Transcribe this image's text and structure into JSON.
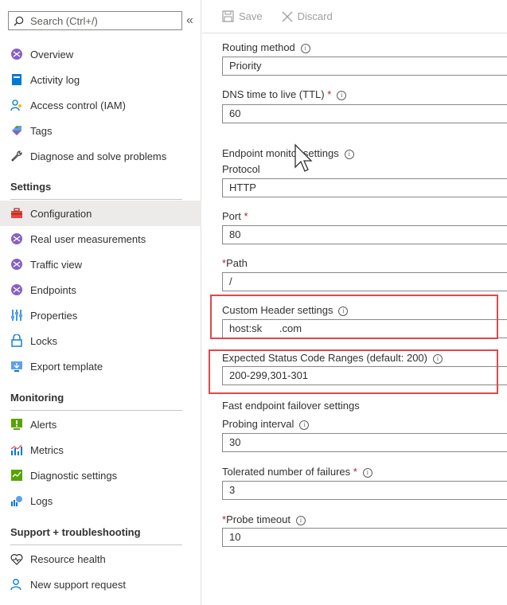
{
  "sidebar": {
    "search_placeholder": "Search (Ctrl+/)",
    "collapse": "«",
    "top_items": [
      {
        "label": "Overview",
        "icon": "overview-icon"
      },
      {
        "label": "Activity log",
        "icon": "activity-log-icon"
      },
      {
        "label": "Access control (IAM)",
        "icon": "access-control-icon"
      },
      {
        "label": "Tags",
        "icon": "tag-icon"
      },
      {
        "label": "Diagnose and solve problems",
        "icon": "wrench-icon"
      }
    ],
    "sections": [
      {
        "title": "Settings",
        "items": [
          {
            "label": "Configuration",
            "icon": "toolbox-icon",
            "active": true
          },
          {
            "label": "Real user measurements",
            "icon": "traffic-manager-icon"
          },
          {
            "label": "Traffic view",
            "icon": "traffic-manager-icon"
          },
          {
            "label": "Endpoints",
            "icon": "traffic-manager-icon"
          },
          {
            "label": "Properties",
            "icon": "properties-icon"
          },
          {
            "label": "Locks",
            "icon": "lock-icon"
          },
          {
            "label": "Export template",
            "icon": "export-icon"
          }
        ]
      },
      {
        "title": "Monitoring",
        "items": [
          {
            "label": "Alerts",
            "icon": "alert-icon"
          },
          {
            "label": "Metrics",
            "icon": "metrics-icon"
          },
          {
            "label": "Diagnostic settings",
            "icon": "diagnostic-icon"
          },
          {
            "label": "Logs",
            "icon": "logs-icon"
          }
        ]
      },
      {
        "title": "Support + troubleshooting",
        "items": [
          {
            "label": "Resource health",
            "icon": "heart-icon"
          },
          {
            "label": "New support request",
            "icon": "support-icon"
          }
        ]
      }
    ]
  },
  "toolbar": {
    "save_label": "Save",
    "discard_label": "Discard"
  },
  "form": {
    "routing_method": {
      "label": "Routing method",
      "value": "Priority"
    },
    "dns_ttl": {
      "label": "DNS time to live (TTL)",
      "required": "*",
      "value": "60"
    },
    "endpoint_monitor": {
      "label": "Endpoint monitor settings"
    },
    "protocol": {
      "label": "Protocol",
      "value": "HTTP"
    },
    "port": {
      "label": "Port",
      "required": "*",
      "value": "80"
    },
    "path": {
      "required": "*",
      "label": "Path",
      "value": "/"
    },
    "custom_header": {
      "label": "Custom Header settings",
      "value": "host:sk      .com"
    },
    "status_codes": {
      "label": "Expected Status Code Ranges (default: 200)",
      "value": "200-299,301-301"
    },
    "failover": {
      "label": "Fast endpoint failover settings"
    },
    "probing_interval": {
      "label": "Probing interval",
      "value": "30"
    },
    "tolerated_failures": {
      "label": "Tolerated number of failures",
      "required": "*",
      "value": "3"
    },
    "probe_timeout": {
      "required": "*",
      "label": "Probe timeout",
      "value": "10"
    }
  },
  "colors": {
    "highlight": "#e0484b",
    "required": "#a4262c",
    "active_bg": "#edebe9"
  }
}
